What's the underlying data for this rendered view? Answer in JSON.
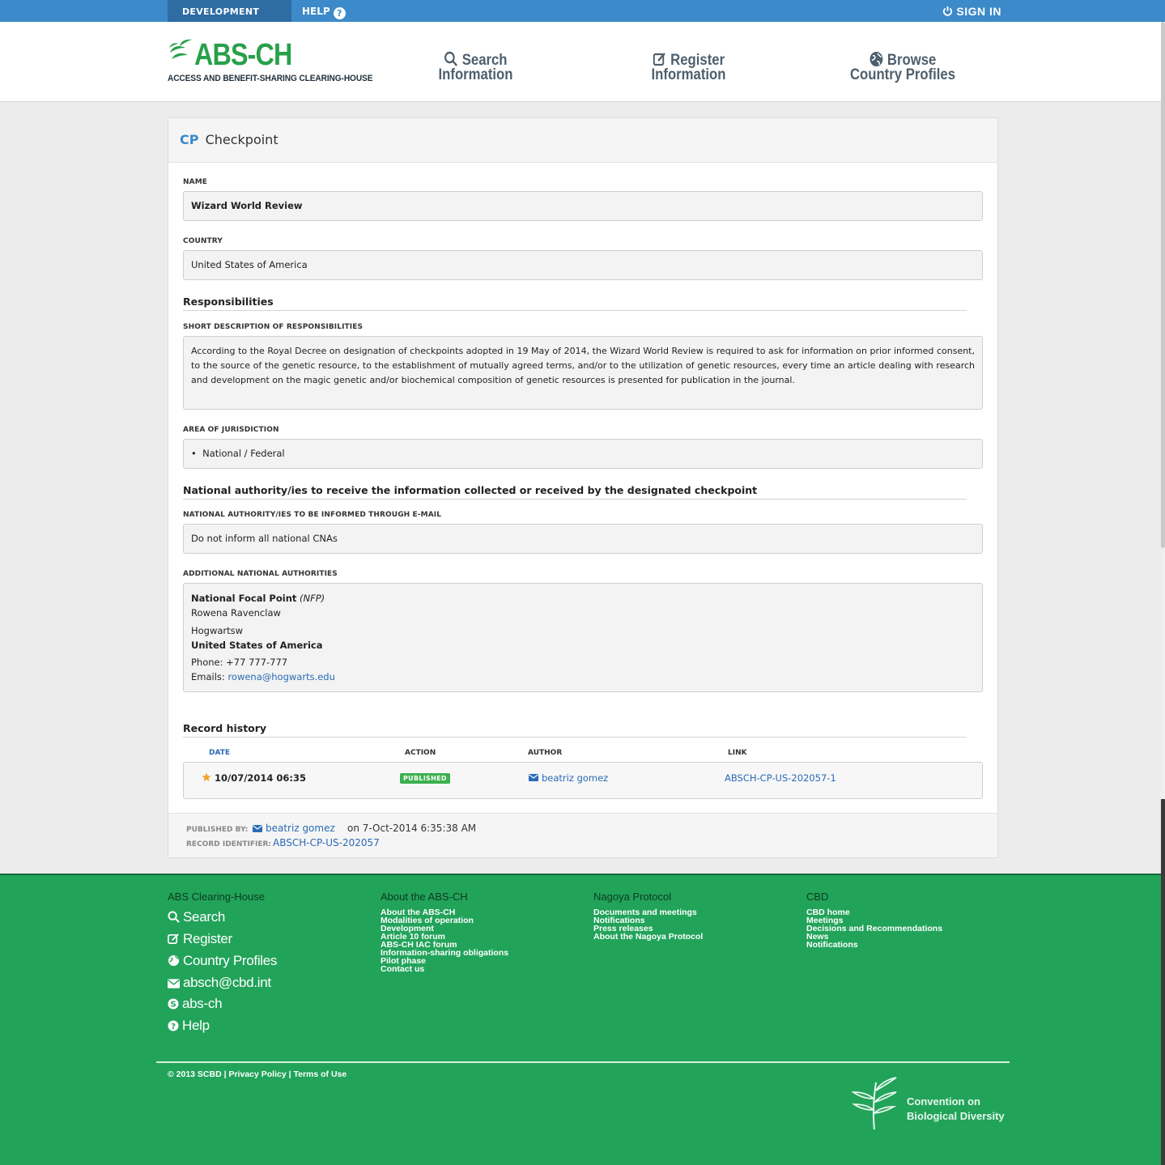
{
  "topbar": {
    "environment": "DEVELOPMENT",
    "help": "HELP",
    "sign_in": "SIGN IN"
  },
  "header": {
    "logo_title": "ABS-CH",
    "logo_subtitle": "ACCESS AND BENEFIT-SHARING CLEARING-HOUSE",
    "nav": [
      {
        "line1": "Search",
        "line2": "Information",
        "icon": "search-icon"
      },
      {
        "line1": "Register",
        "line2": "Information",
        "icon": "edit-icon"
      },
      {
        "line1": "Browse",
        "line2": "Country Profiles",
        "icon": "globe-icon"
      }
    ]
  },
  "record": {
    "type_code": "CP",
    "type_label": "Checkpoint",
    "name_label": "NAME",
    "name_value": "Wizard World Review",
    "country_label": "COUNTRY",
    "country_value": "United States of America",
    "responsibilities_heading": "Responsibilities",
    "short_desc_label": "SHORT DESCRIPTION OF RESPONSIBILITIES",
    "short_desc_value": "According to the Royal Decree on designation of checkpoints adopted in 19 May of 2014, the Wizard World Review is required to ask for information on prior informed consent, to the source of the genetic resource, to the establishment of mutually agreed terms, and/or to the utilization of genetic resources, every time an article dealing with research and development on the magic genetic and/or biochemical composition of genetic resources is presented for publication in the journal.",
    "jurisdiction_label": "AREA OF JURISDICTION",
    "jurisdiction_value": "National / Federal",
    "authorities_heading": "National authority/ies to receive the information collected or received by the designated checkpoint",
    "email_inform_label": "NATIONAL AUTHORITY/IES TO BE INFORMED THROUGH E-MAIL",
    "email_inform_value": "Do not inform all national CNAs",
    "additional_label": "ADDITIONAL NATIONAL AUTHORITIES",
    "contact": {
      "role": "National Focal Point",
      "role_abbr": "(NFP)",
      "person": "Rowena Ravenclaw",
      "org": "Hogwartsw",
      "country": "United States of America",
      "phone": "Phone: +77 777-777",
      "emails_label": "Emails:",
      "email": "rowena@hogwarts.edu"
    },
    "history_heading": "Record history",
    "history_columns": [
      "DATE",
      "ACTION",
      "AUTHOR",
      "LINK"
    ],
    "history_rows": [
      {
        "date": "10/07/2014 06:35",
        "action": "PUBLISHED",
        "author": "beatriz gomez",
        "link": "ABSCH-CP-US-202057-1"
      }
    ],
    "published_by_label": "PUBLISHED BY:",
    "published_by": "beatriz gomez",
    "published_on": "on 7-Oct-2014 6:35:38 AM",
    "record_id_label": "RECORD IDENTIFIER:",
    "record_id": "ABSCH-CP-US-202057"
  },
  "footer": {
    "col1_title": "ABS Clearing-House",
    "col1_links": [
      "Search",
      "Register",
      "Country Profiles",
      "absch@cbd.int",
      "abs-ch",
      "Help"
    ],
    "col2_title": "About the ABS-CH",
    "col2_links": [
      "About the ABS-CH",
      "Modalities of operation",
      "Development",
      "Article 10 forum",
      "ABS-CH IAC forum",
      "Information-sharing obligations",
      "Pilot phase",
      "Contact us"
    ],
    "col3_title": "Nagoya Protocol",
    "col3_links": [
      "Documents and meetings",
      "Notifications",
      "Press releases",
      "About the Nagoya Protocol"
    ],
    "col4_title": "CBD",
    "col4_links": [
      "CBD home",
      "Meetings",
      "Decisions and Recommendations",
      "News",
      "Notifications"
    ],
    "copyright": "© 2013 SCBD",
    "privacy": "Privacy Policy",
    "terms": "Terms of Use",
    "cbd_line1": "Convention on",
    "cbd_line2": "Biological Diversity"
  },
  "colors": {
    "brand_green": "#28a04a",
    "topbar_blue": "#3c8ac9",
    "footer_green": "#22a35a",
    "link_blue": "#2a6ab5"
  }
}
